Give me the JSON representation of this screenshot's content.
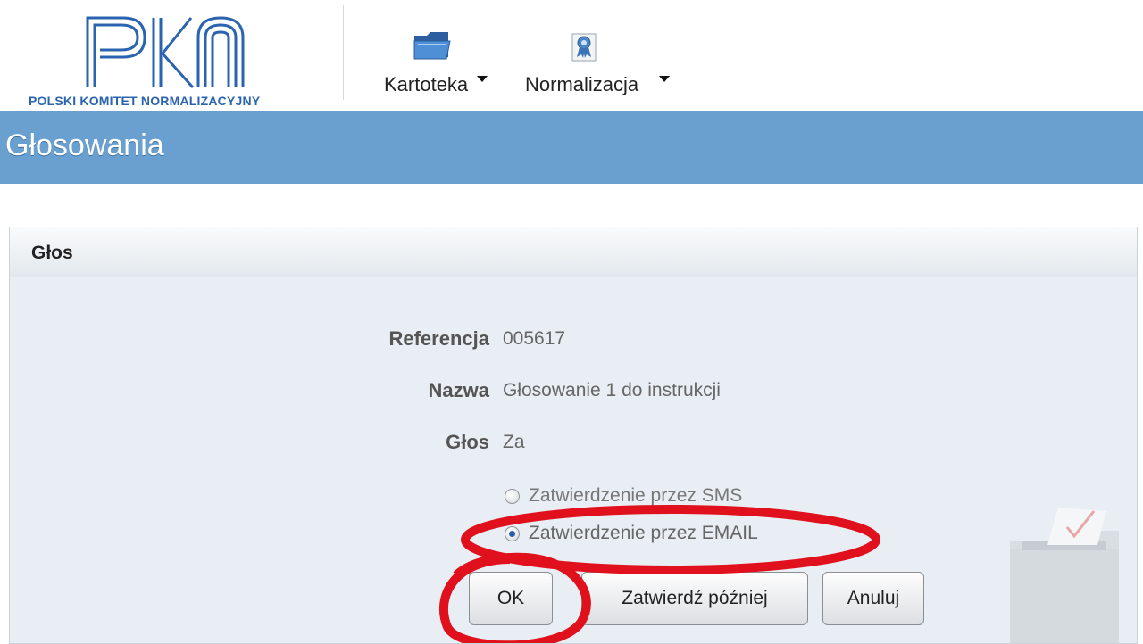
{
  "header": {
    "logo_text": "POLSKI KOMITET NORMALIZACYJNY",
    "menus": [
      {
        "label": "Kartoteka",
        "icon": "folder-icon"
      },
      {
        "label": "Normalizacja",
        "icon": "certificate-icon"
      }
    ]
  },
  "page": {
    "title": "Głosowania"
  },
  "panel": {
    "title": "Głos",
    "fields": {
      "reference_label": "Referencja",
      "reference_value": "005617",
      "name_label": "Nazwa",
      "name_value": "Głosowanie 1 do instrukcji",
      "vote_label": "Głos",
      "vote_value": "Za"
    },
    "confirmation_options": [
      {
        "label": "Zatwierdzenie przez SMS",
        "selected": false
      },
      {
        "label": "Zatwierdzenie przez EMAIL",
        "selected": true
      }
    ],
    "buttons": {
      "ok": "OK",
      "later": "Zatwierdź później",
      "cancel": "Anuluj"
    }
  },
  "colors": {
    "title_band": "#69a0d0",
    "annotation": "#e0101c",
    "logo": "#2a64b0"
  }
}
